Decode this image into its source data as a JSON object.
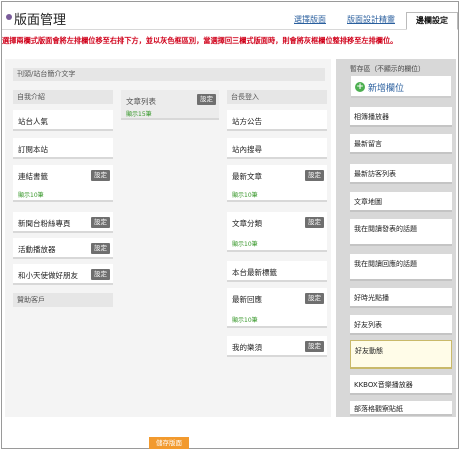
{
  "header": {
    "title": "版面管理",
    "tabs": [
      {
        "label": "選擇版面",
        "active": false
      },
      {
        "label": "版面設計精靈",
        "active": false
      },
      {
        "label": "邊欄設定",
        "active": true
      }
    ]
  },
  "notice": "選擇兩欄式版面會將左排欄位移至右排下方，並以灰色框區別，當選擇回三欄式版面時，則會將灰框欄位整排移至左排欄位。",
  "main": {
    "intro_label": "刊頭/站台簡介文字",
    "set_label": "設定",
    "columns": [
      {
        "header": "自我介紹",
        "items": [
          {
            "name": "站台人氣"
          },
          {
            "name": "訂閱本站"
          },
          {
            "name": "連結書籤",
            "settings": true,
            "sub": "顯示10筆"
          },
          {
            "name": "新聞台粉絲專頁",
            "settings": true
          },
          {
            "name": "活動播放器",
            "settings": true
          },
          {
            "name": "和小天使做好朋友",
            "settings": true
          }
        ],
        "footer": "贊助客戶"
      },
      {
        "header": "文章列表",
        "header_settings": true,
        "header_sub": "顯示15筆"
      },
      {
        "header": "台長登入",
        "items": [
          {
            "name": "站方公告"
          },
          {
            "name": "站內搜尋"
          },
          {
            "name": "最新文章",
            "settings": true,
            "sub": "顯示10筆"
          },
          {
            "name": "文章分類",
            "settings": true,
            "sub": "顯示10筆"
          },
          {
            "name": "本台最新標籤"
          },
          {
            "name": "最新回應",
            "settings": true,
            "sub": "顯示10筆"
          },
          {
            "name": "我的樂須",
            "settings": true
          }
        ]
      }
    ]
  },
  "sidebar": {
    "header": "暫存區（不顯示的欄位）",
    "add_label": "新增欄位",
    "items": [
      {
        "name": "相簿播放器"
      },
      {
        "name": "最新留言"
      },
      {
        "name": "最新訪客列表"
      },
      {
        "name": "文章地圖"
      },
      {
        "name": "我在閱讀發表的話題"
      },
      {
        "name": "我在閱讀回應的話題"
      },
      {
        "name": "好時光點播"
      },
      {
        "name": "好友列表"
      },
      {
        "name": "好友動態",
        "highlight": true
      },
      {
        "name": "KKBOX音樂播放器"
      },
      {
        "name": "部落格觀察貼紙"
      }
    ]
  },
  "save_label": "儲存版面",
  "colors": {
    "notice": "#d0021b",
    "sub_text": "#3b9a2e",
    "settings_button": "#6f6f6f",
    "save_button": "#f29a2e",
    "add_icon": "#4caf50",
    "tab_link": "#2a5f9e"
  }
}
